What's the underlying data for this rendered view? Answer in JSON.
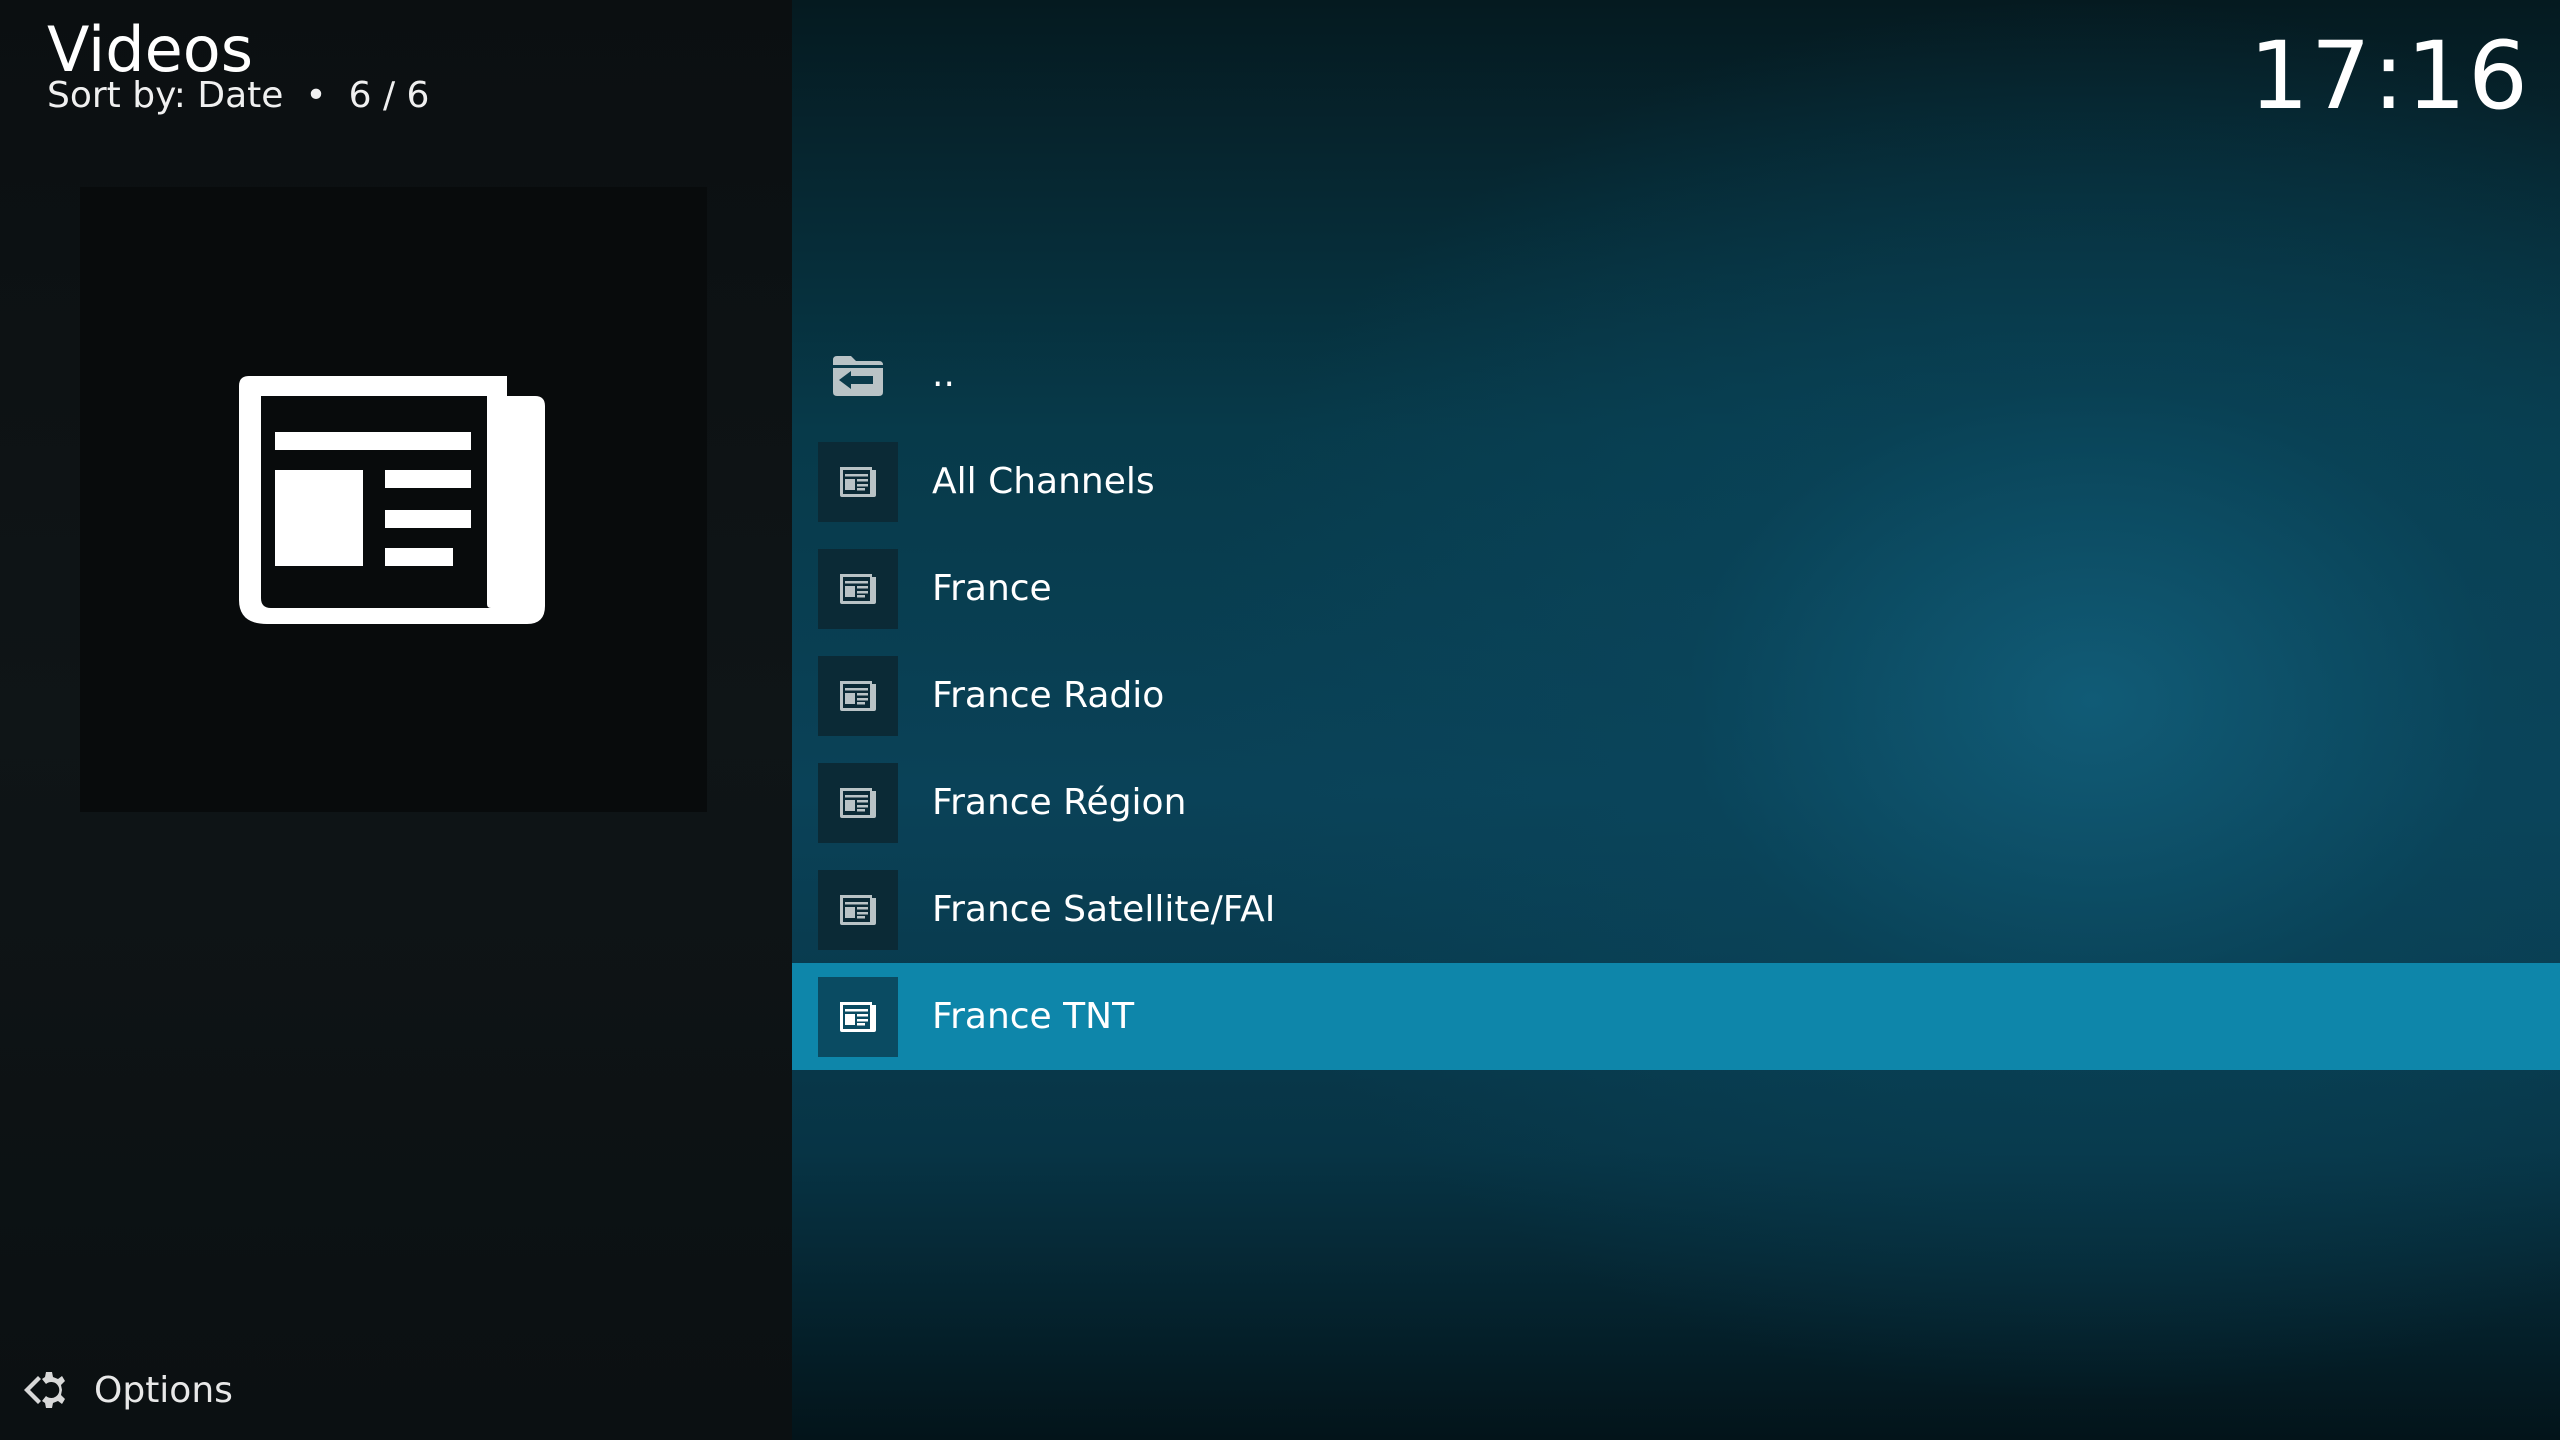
{
  "header": {
    "title": "Videos",
    "sort_label": "Sort by: Date",
    "separator": "•",
    "count": "6 / 6"
  },
  "clock": "17:16",
  "thumbnail": {
    "icon": "newspaper-icon"
  },
  "options": {
    "label": "Options",
    "icon": "options-gear-icon"
  },
  "list": {
    "parent": {
      "label": "..",
      "icon": "folder-back-icon"
    },
    "items": [
      {
        "label": "All Channels",
        "icon": "newspaper-icon",
        "selected": false
      },
      {
        "label": "France",
        "icon": "newspaper-icon",
        "selected": false
      },
      {
        "label": "France Radio",
        "icon": "newspaper-icon",
        "selected": false
      },
      {
        "label": "France Région",
        "icon": "newspaper-icon",
        "selected": false
      },
      {
        "label": "France Satellite/FAI",
        "icon": "newspaper-icon",
        "selected": false
      },
      {
        "label": "France TNT",
        "icon": "newspaper-icon",
        "selected": true
      }
    ]
  },
  "colors": {
    "selected_row": "#0e86aa",
    "panel": "#0f1517"
  }
}
